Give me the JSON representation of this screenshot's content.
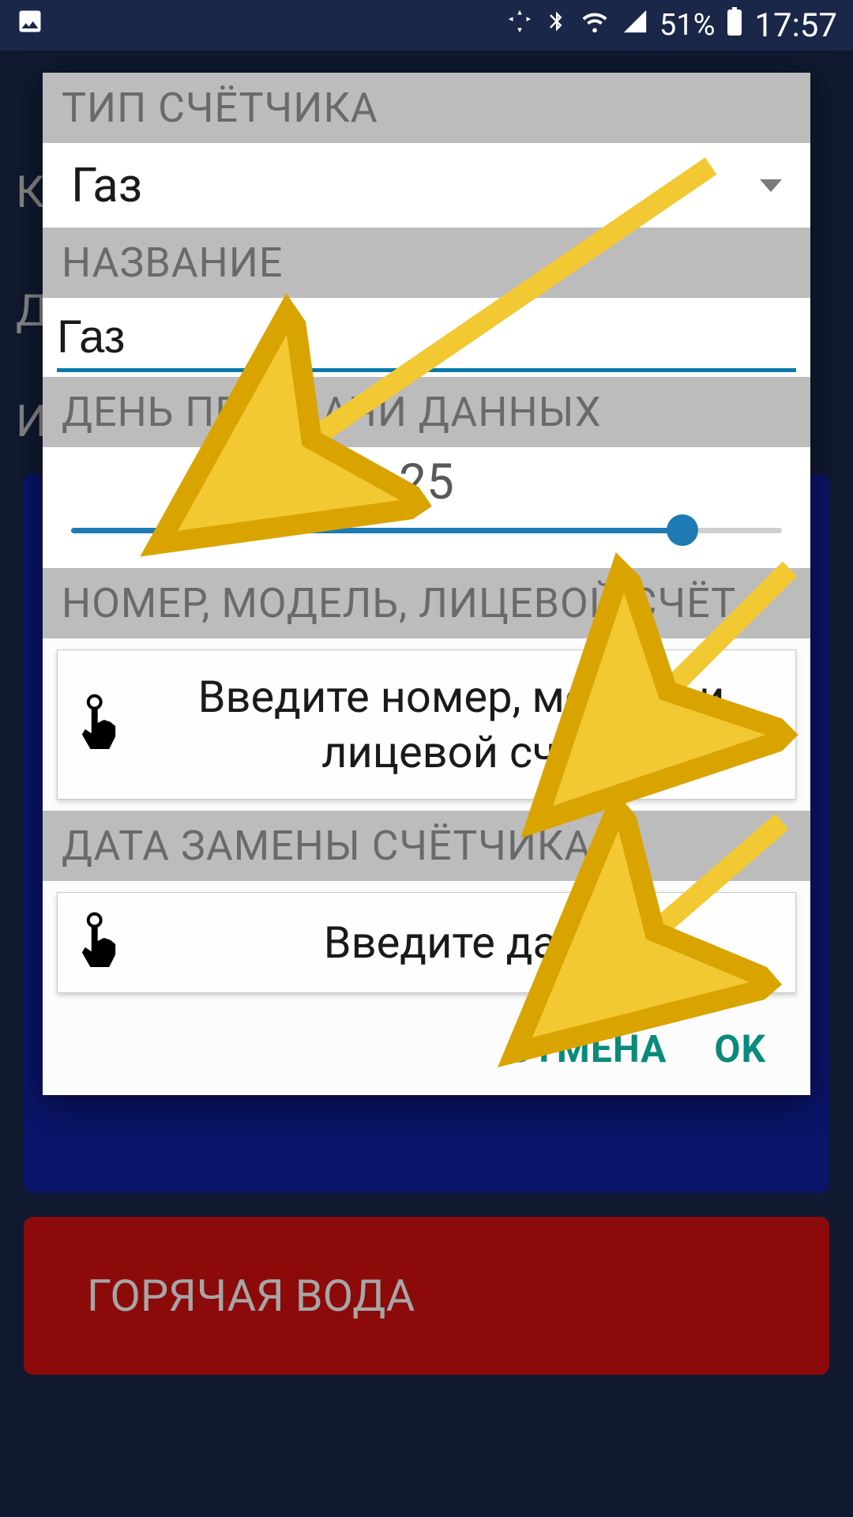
{
  "status_bar": {
    "battery_percent": "51%",
    "time": "17:57"
  },
  "background": {
    "red_card_label": "ГОРЯЧАЯ ВОДА"
  },
  "dialog": {
    "sections": {
      "type": {
        "label": "ТИП СЧЁТЧИКА",
        "value": "Газ"
      },
      "name": {
        "label": "НАЗВАНИЕ",
        "value": "Газ"
      },
      "day": {
        "label": "ДЕНЬ ПЕРЕДАЧИ ДАННЫХ",
        "value": "25",
        "min": 1,
        "max": 31,
        "fill_pct": 86
      },
      "model": {
        "label": "НОМЕР, МОДЕЛЬ, ЛИЦЕВОЙ СЧЁТ",
        "button": "Введите номер, модель и лицевой счет"
      },
      "date": {
        "label": "ДАТА ЗАМЕНЫ СЧЁТЧИКА",
        "button": "Введите дату"
      }
    },
    "actions": {
      "cancel": "ОТМЕНА",
      "ok": "OK"
    }
  },
  "colors": {
    "accent": "#1e7bb3",
    "header_bg": "#bcbcbc",
    "action": "#0a8a7a"
  }
}
